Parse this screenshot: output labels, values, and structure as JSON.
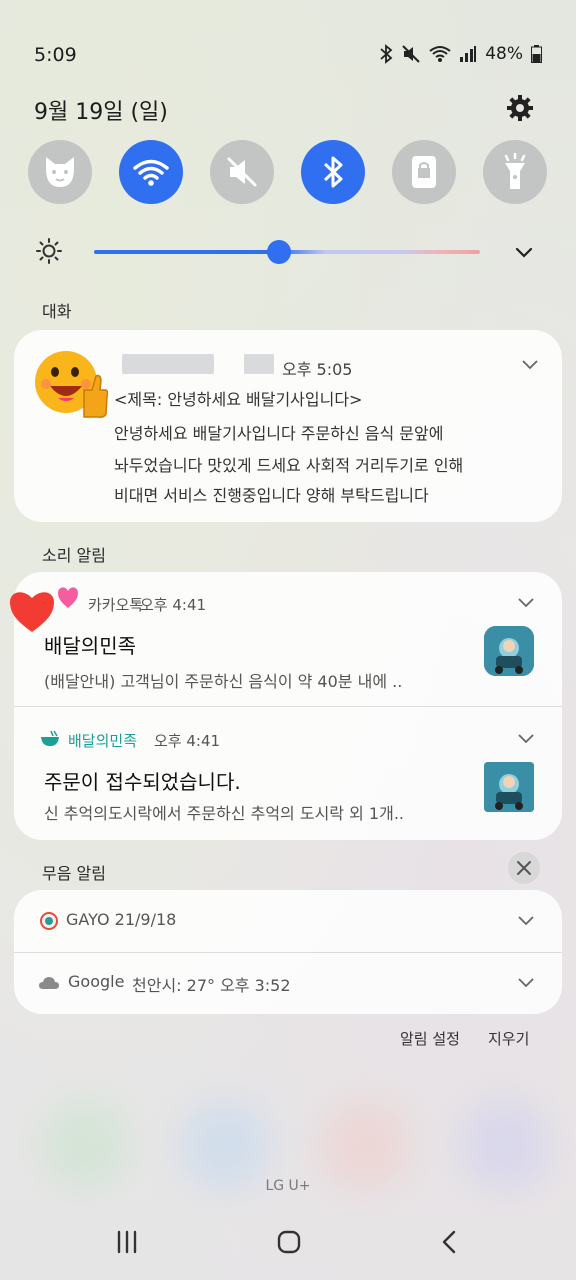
{
  "status": {
    "time": "5:09",
    "battery": "48%",
    "icons": [
      "bluetooth-icon",
      "mute-icon",
      "wifi-icon",
      "signal-icon",
      "battery-icon"
    ]
  },
  "header": {
    "date": "9월 19일 (일)"
  },
  "quick_settings": [
    {
      "name": "cat-icon",
      "on": false
    },
    {
      "name": "wifi-icon",
      "on": true
    },
    {
      "name": "mute-icon",
      "on": false
    },
    {
      "name": "bluetooth-icon",
      "on": true
    },
    {
      "name": "lock-rotate-icon",
      "on": false
    },
    {
      "name": "flashlight-icon",
      "on": false
    }
  ],
  "brightness": {
    "level": 0.48
  },
  "sections": {
    "conversation": "대화",
    "sound_alerts": "소리 알림",
    "silent_alerts": "무음 알림"
  },
  "conversation": {
    "time": "오후 5:05",
    "lines": [
      "<제목: 안녕하세요 배달기사입니다>",
      "안녕하세요 배달기사입니다 주문하신 음식 문앞에",
      "놔두었습니다 맛있게 드세요 사회적 거리두기로 인해",
      "비대면 서비스 진행중입니다 양해 부탁드립니다"
    ]
  },
  "sound_notifs": [
    {
      "app": "카카오톡",
      "time": "오후 4:41",
      "title": "배달의민족",
      "body": "(배달안내) 고객님이 주문하신 음식이 약 40분 내에 .."
    },
    {
      "app": "배달의민족",
      "time": "오후 4:41",
      "title": "주문이 접수되었습니다.",
      "body": "신 추억의도시락에서 주문하신 추억의 도시락 외 1개.."
    }
  ],
  "silent_notifs": [
    {
      "app": "GAYO",
      "text": "GAYO  21/9/18"
    },
    {
      "app": "Google",
      "text": "천안시: 27°  오후 3:52"
    }
  ],
  "footer": {
    "settings": "알림 설정",
    "clear": "지우기",
    "carrier": "LG U+"
  },
  "colors": {
    "accent": "#2f6ff0",
    "baemin": "#1aa098"
  }
}
